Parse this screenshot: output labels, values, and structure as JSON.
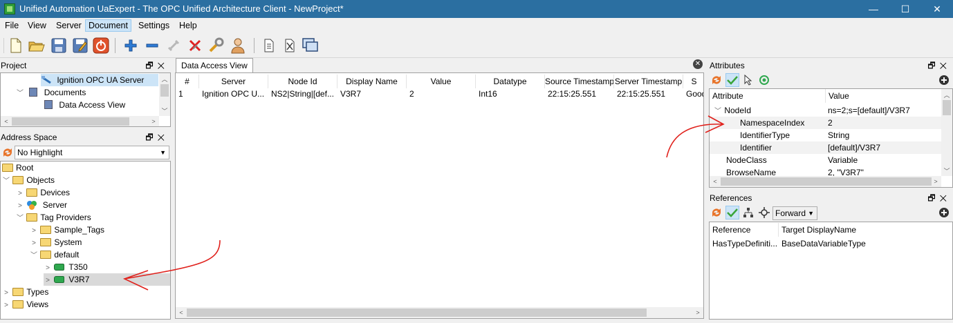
{
  "window": {
    "title": "Unified Automation UaExpert - The OPC Unified Architecture Client - NewProject*",
    "minimize": "—",
    "maximize": "☐",
    "close": "✕"
  },
  "menu": [
    "File",
    "View",
    "Server",
    "Document",
    "Settings",
    "Help"
  ],
  "toolbar": {
    "icons": [
      "new-project-icon",
      "open-project-icon",
      "save-project-icon",
      "save-as-icon",
      "quit-icon",
      "add-server-icon",
      "remove-server-icon",
      "connect-icon",
      "disconnect-icon",
      "settings-icon",
      "user-icon",
      "add-document-icon",
      "remove-document-icon",
      "window-icon"
    ]
  },
  "project_panel": {
    "title": "Project",
    "items": [
      {
        "label": "Ignition OPC UA Server"
      },
      {
        "label": "Documents"
      },
      {
        "label": "Data Access View"
      }
    ]
  },
  "address_space": {
    "title": "Address Space",
    "highlight": "No Highlight",
    "tree": [
      {
        "label": "Root"
      },
      {
        "label": "Objects"
      },
      {
        "label": "Devices"
      },
      {
        "label": "Server"
      },
      {
        "label": "Tag Providers"
      },
      {
        "label": "Sample_Tags"
      },
      {
        "label": "System"
      },
      {
        "label": "default"
      },
      {
        "label": "T350"
      },
      {
        "label": "V3R7"
      },
      {
        "label": "Types"
      },
      {
        "label": "Views"
      }
    ]
  },
  "data_access_view": {
    "tab_label": "Data Access View",
    "columns": [
      "#",
      "Server",
      "Node Id",
      "Display Name",
      "Value",
      "Datatype",
      "Source Timestamp",
      "Server Timestamp",
      "S"
    ],
    "rows": [
      {
        "num": "1",
        "server": "Ignition OPC U...",
        "node_id": "NS2|String|[def...",
        "display_name": "V3R7",
        "value": "2",
        "datatype": "Int16",
        "source_ts": "22:15:25.551",
        "server_ts": "22:15:25.551",
        "status": "Good"
      }
    ]
  },
  "attributes_panel": {
    "title": "Attributes",
    "columns": [
      "Attribute",
      "Value"
    ],
    "rows": [
      {
        "name": "NodeId",
        "value": "ns=2;s=[default]/V3R7"
      },
      {
        "name": "NamespaceIndex",
        "value": "2"
      },
      {
        "name": "IdentifierType",
        "value": "String"
      },
      {
        "name": "Identifier",
        "value": "[default]/V3R7"
      },
      {
        "name": "NodeClass",
        "value": "Variable"
      },
      {
        "name": "BrowseName",
        "value": "2, \"V3R7\""
      }
    ]
  },
  "references_panel": {
    "title": "References",
    "direction": "Forward",
    "columns": [
      "Reference",
      "Target DisplayName"
    ],
    "rows": [
      {
        "reference": "HasTypeDefiniti...",
        "target": "BaseDataVariableType"
      }
    ]
  },
  "colors": {
    "titlebar": "#2b6fa1",
    "selection": "#cce4f7",
    "annotation": "#e0201b"
  }
}
